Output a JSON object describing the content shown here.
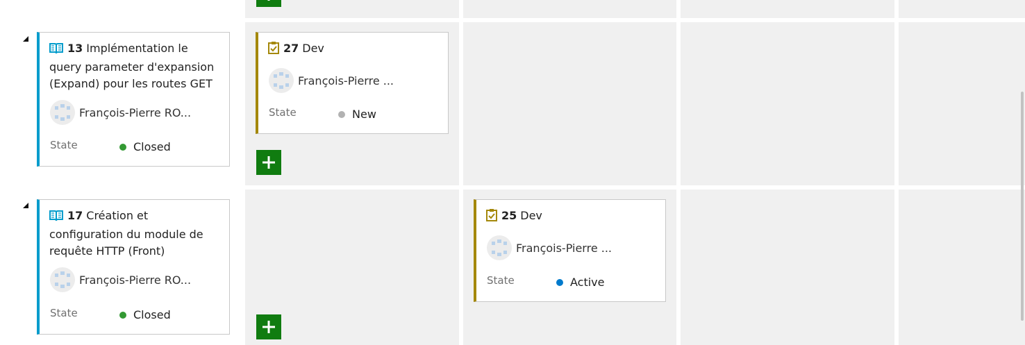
{
  "colors": {
    "story_accent": "#009ccc",
    "task_accent": "#a4880a",
    "add_button": "#107c10",
    "state_closed": "#339933",
    "state_new": "#b2b2b2",
    "state_active": "#007acc"
  },
  "rows": [
    {
      "story": {
        "icon": "book-icon",
        "id": "13",
        "title": "Implémentation le query parameter d'expansion (Expand)  pour les routes GET",
        "assignee": "François-Pierre RO...",
        "state_label": "State",
        "state": "Closed"
      },
      "tasks": [
        {
          "column": "new",
          "icon": "task-clipboard-icon",
          "id": "27",
          "title": "Dev",
          "assignee": "François-Pierre ...",
          "state_label": "State",
          "state": "New"
        }
      ]
    },
    {
      "story": {
        "icon": "book-icon",
        "id": "17",
        "title": "Création et configuration du module de requête HTTP (Front)",
        "assignee": "François-Pierre RO...",
        "state_label": "State",
        "state": "Closed"
      },
      "tasks": [
        {
          "column": "active",
          "icon": "task-clipboard-icon",
          "id": "25",
          "title": "Dev",
          "assignee": "François-Pierre ...",
          "state_label": "State",
          "state": "Active"
        }
      ]
    }
  ]
}
